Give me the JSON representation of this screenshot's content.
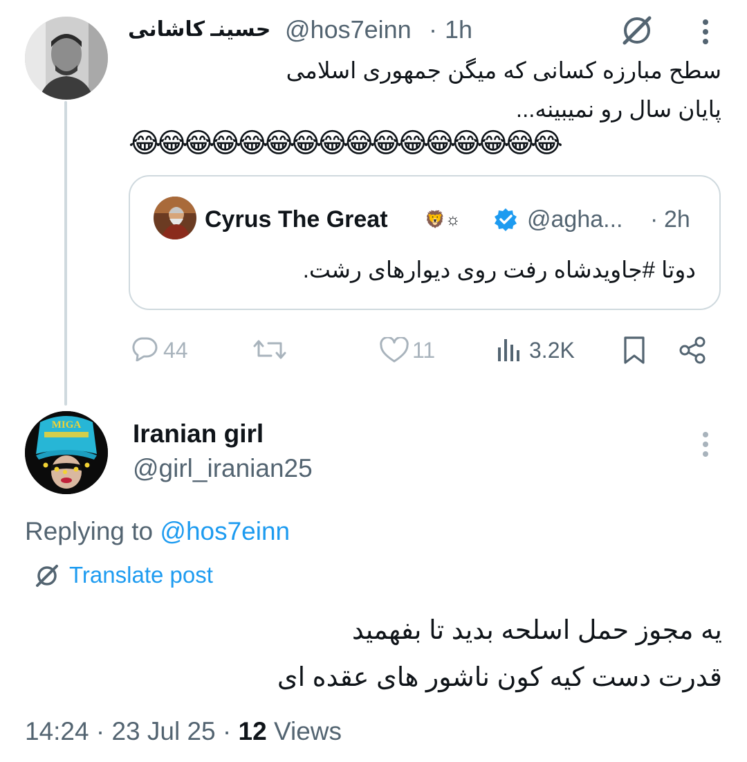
{
  "parent_tweet": {
    "author_name": "حسینـ کاشانی",
    "handle": "@hos7einn",
    "sep": "·",
    "time": "1h",
    "text_line1": "سطح مبارزه کسانی که میگن جمهوری اسلامی",
    "text_line2": "پایان سال رو نمیبینه...",
    "emoji_row": "😂😂😂😂😂😂😂😂😂😂😂😂😂😂😂😂",
    "quote": {
      "author_name": "Cyrus The Great",
      "name_symbols": "🦁☼",
      "handle": "@agha...",
      "sep": "·",
      "time": "2h",
      "text": "دوتا #جاویدشاه رفت روی دیوارهای رشت."
    },
    "metrics": {
      "replies": "44",
      "likes": "11",
      "views": "3.2K"
    }
  },
  "reply_tweet": {
    "author_name": "Iranian girl",
    "handle": "@girl_iranian25",
    "avatar_hat_text": "MIGA",
    "replying_label": "Replying to",
    "replying_handle": "@hos7einn",
    "translate_label": "Translate post",
    "text_line1": "یه مجوز حمل اسلحه بدید تا بفهمید",
    "text_line2": "قدرت دست کیه کون ناشور های عقده ای",
    "timestamp": "14:24 · 23 Jul 25 ·",
    "views_count": "12",
    "views_label": "Views"
  },
  "colors": {
    "text": "#0f1419",
    "secondary": "#536471",
    "accent": "#1d9bf0",
    "border": "#cfd9de",
    "thread_line": "#cfd9de"
  }
}
